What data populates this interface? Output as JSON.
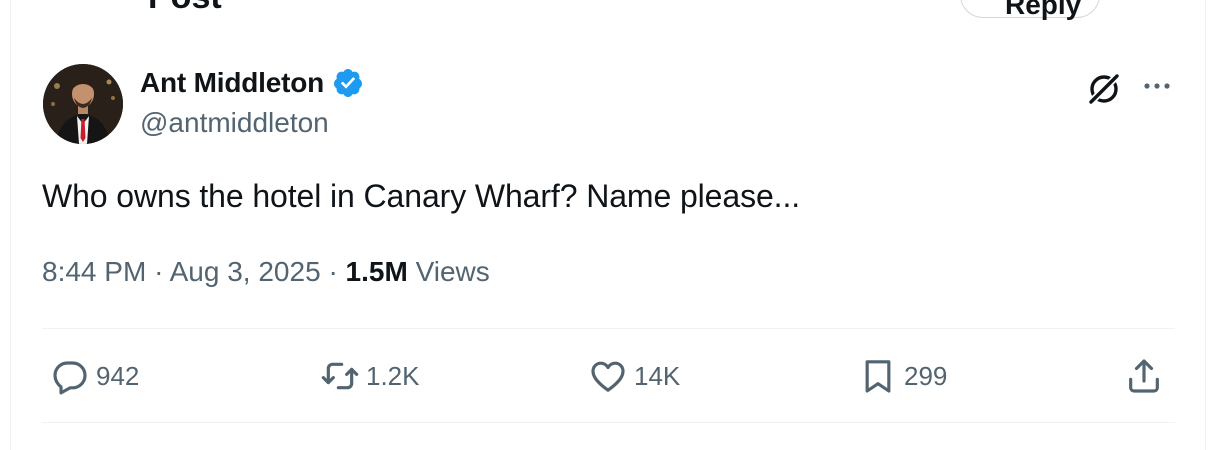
{
  "header": {
    "title": "Post",
    "reply_button_label": "Reply"
  },
  "author": {
    "display_name": "Ant Middleton",
    "handle": "@antmiddleton",
    "verified": true
  },
  "tweet": {
    "text": "Who owns the hotel in Canary Wharf? Name please...",
    "time": "8:44 PM",
    "separator1": "·",
    "date": "Aug 3, 2025",
    "separator2": "·",
    "views_count": "1.5M",
    "views_label": "Views"
  },
  "actions": {
    "replies": "942",
    "reposts": "1.2K",
    "likes": "14K",
    "bookmarks": "299"
  },
  "colors": {
    "text": "#0f1419",
    "secondary": "#536471",
    "verified": "#1d9bf0",
    "divider": "#eff3f4"
  },
  "icons": [
    "grok-icon",
    "more-icon",
    "verified-badge-icon",
    "reply-icon",
    "repost-icon",
    "like-icon",
    "bookmark-icon",
    "share-icon"
  ]
}
